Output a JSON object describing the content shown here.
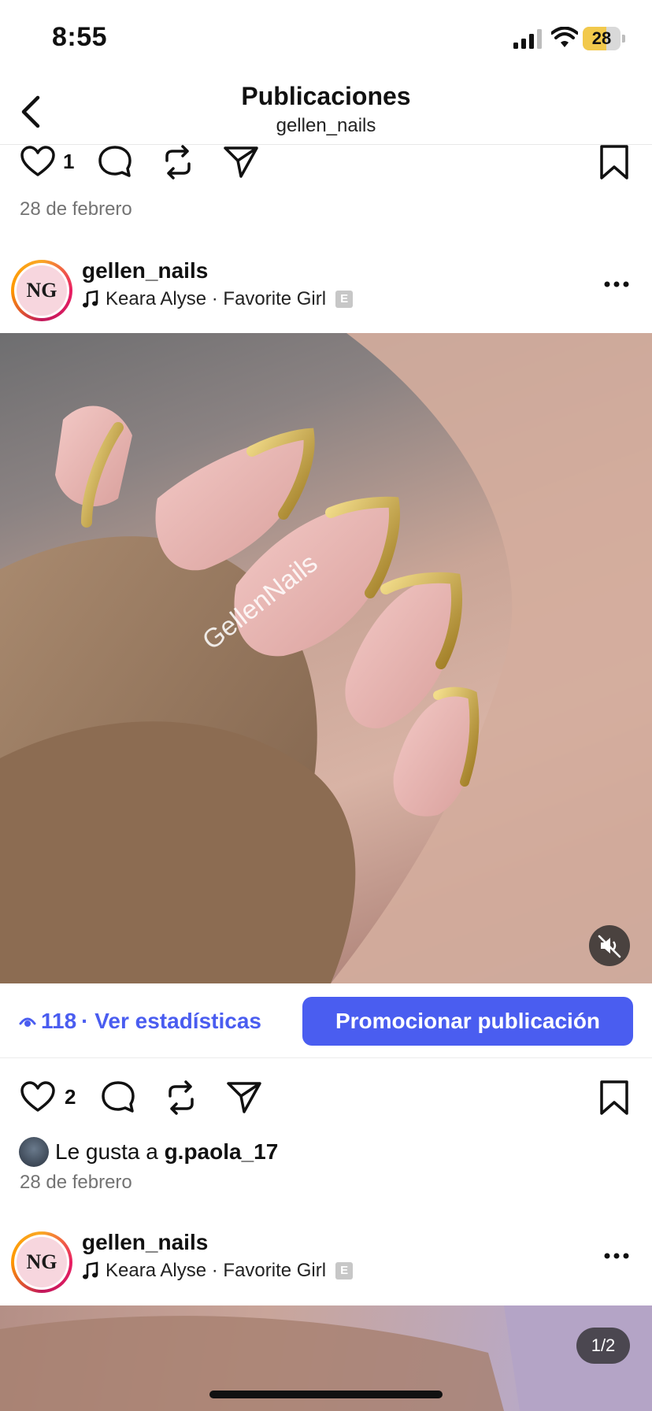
{
  "status_bar": {
    "time": "8:55",
    "battery": "28",
    "battery_fraction": 0.28
  },
  "nav": {
    "title": "Publicaciones",
    "subtitle": "gellen_nails"
  },
  "post1_bottom": {
    "like_count": "1",
    "date": "28 de febrero"
  },
  "post2": {
    "username": "gellen_nails",
    "avatar_initials": "NG",
    "music": "Keara Alyse · Favorite Girl",
    "explicit_badge": "E",
    "watermark": "GellenNails",
    "views": "118",
    "stats_label": "· Ver estadísticas",
    "promote_label": "Promocionar publicación",
    "like_count": "2",
    "liked_by_prefix": "Le gusta a",
    "liked_by_user": "g.paola_17",
    "date": "28 de febrero"
  },
  "post3": {
    "username": "gellen_nails",
    "avatar_initials": "NG",
    "music": "Keara Alyse · Favorite Girl",
    "explicit_badge": "E",
    "pager": "1/2"
  },
  "colors": {
    "accent": "#4a5df0",
    "date_gray": "#737373"
  },
  "icons": [
    "back-chevron-icon",
    "heart-icon",
    "comment-icon",
    "repost-icon",
    "share-icon",
    "bookmark-icon",
    "music-note-icon",
    "more-icon",
    "mute-icon",
    "eye-icon"
  ]
}
